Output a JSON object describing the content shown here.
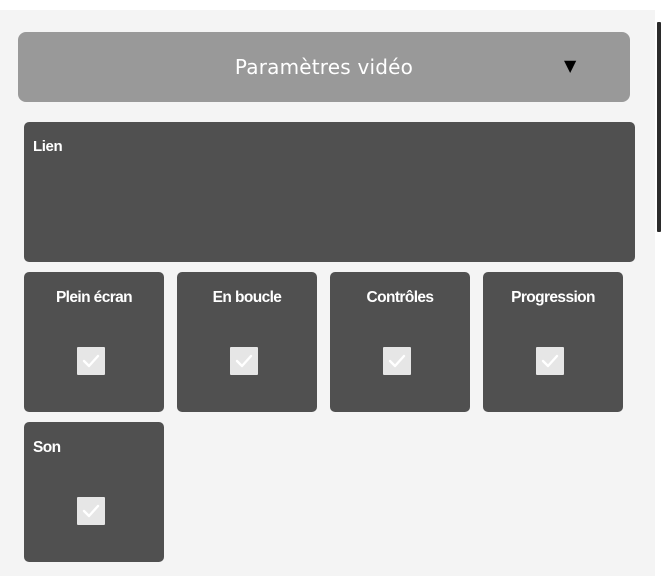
{
  "header": {
    "title": "Paramètres vidéo",
    "arrow": "▼"
  },
  "link": {
    "label": "Lien",
    "value": ""
  },
  "options": [
    {
      "label": "Plein écran",
      "checked": true
    },
    {
      "label": "En boucle",
      "checked": true
    },
    {
      "label": "Contrôles",
      "checked": true
    },
    {
      "label": "Progression",
      "checked": true
    },
    {
      "label": "Son",
      "checked": true
    }
  ],
  "colors": {
    "panel": "#f4f4f4",
    "header": "#999999",
    "tile": "#505050",
    "checkbox": "#e6e6e6",
    "checkmark": "#ffffff"
  },
  "icons": {
    "dropdown": "triangle-down-icon",
    "check": "checkmark-icon"
  }
}
